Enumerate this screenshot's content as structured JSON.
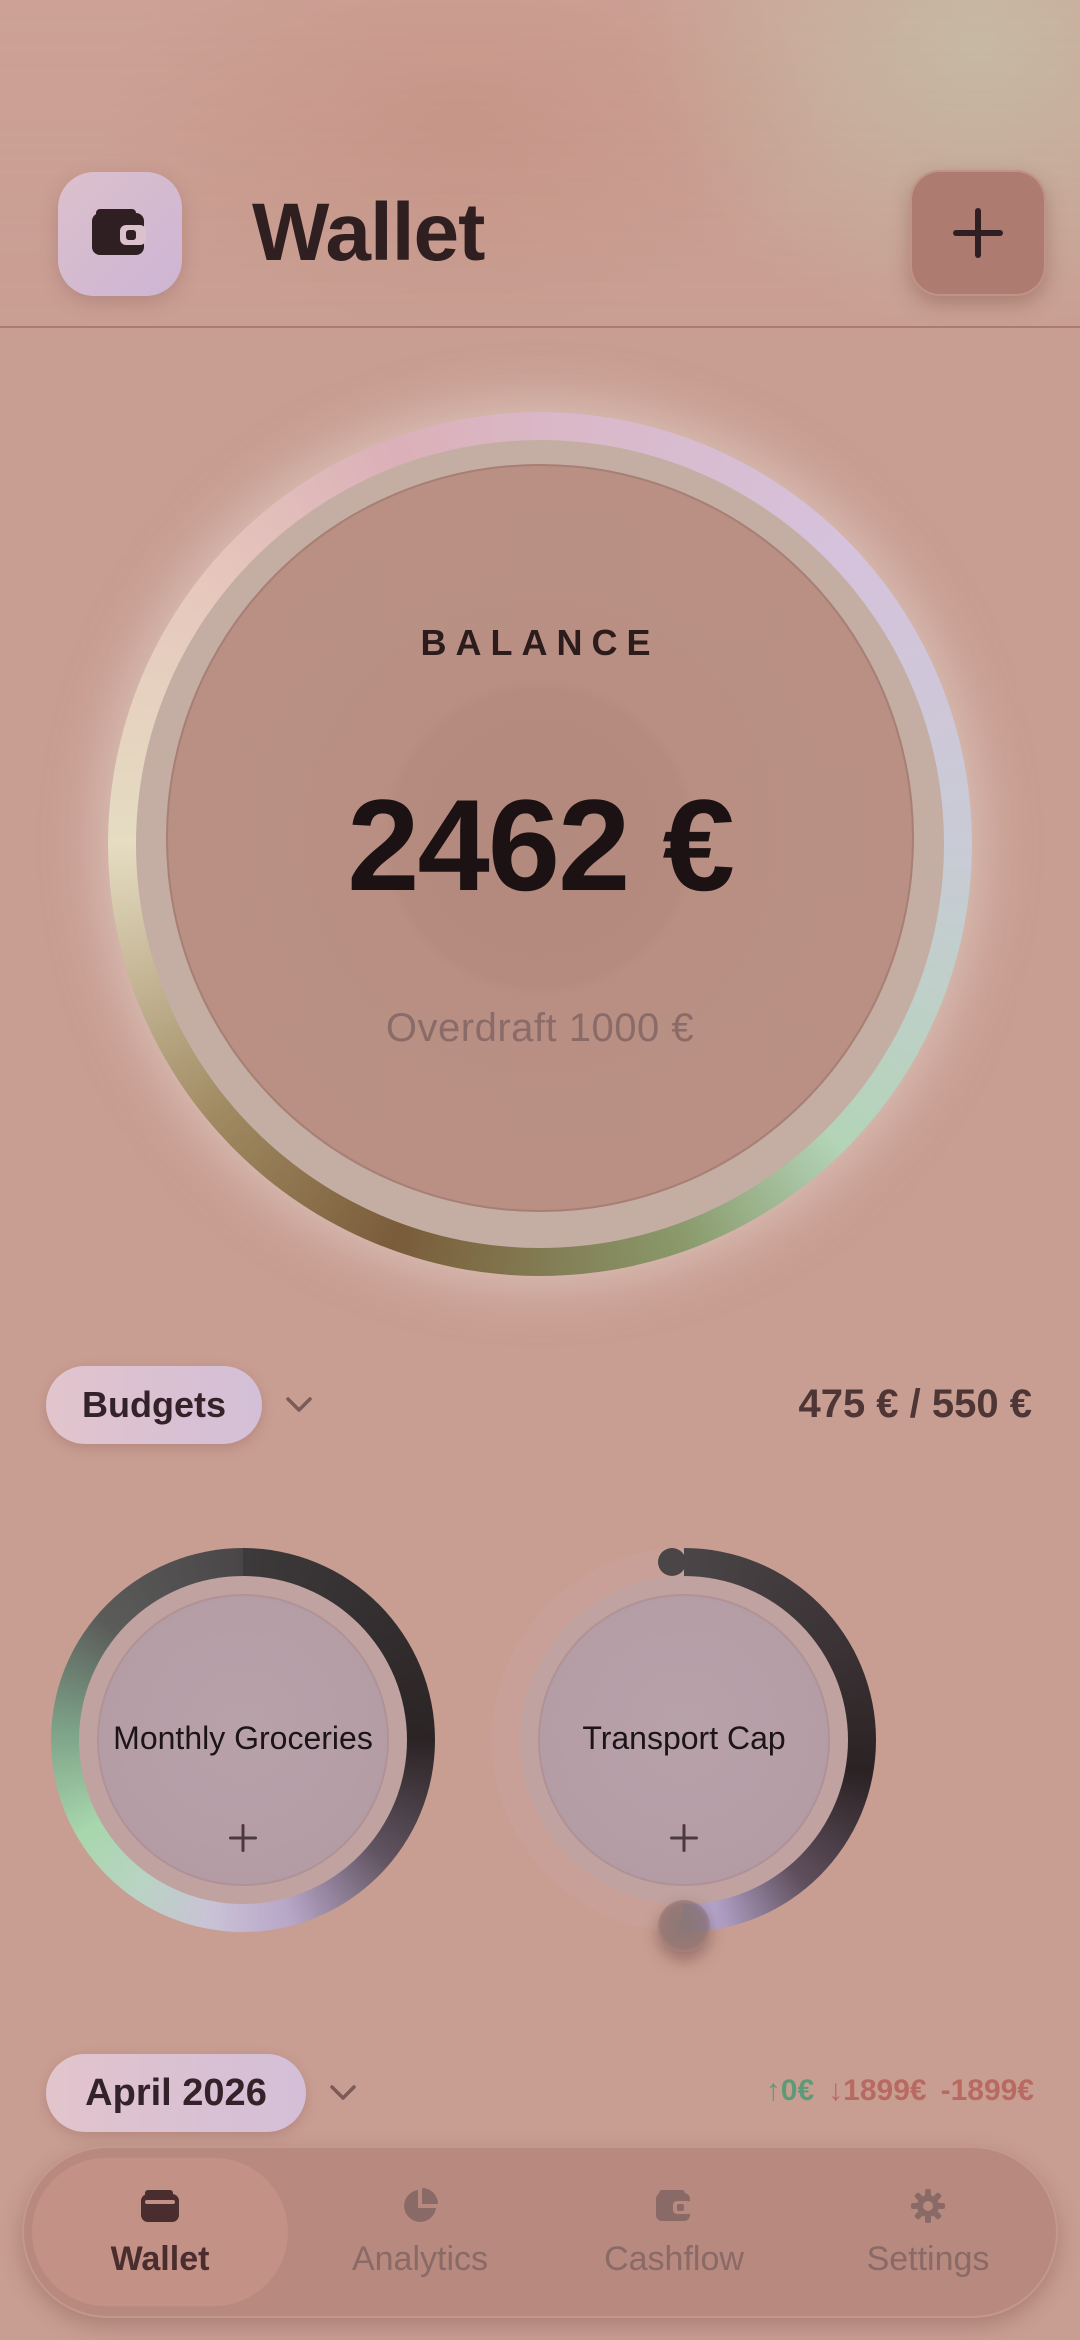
{
  "header": {
    "title": "Wallet",
    "app_icon": "wallet-icon",
    "add_icon": "plus-icon"
  },
  "balance": {
    "label": "BALANCE",
    "amount": "2462 €",
    "overdraft": "Overdraft 1000 €"
  },
  "budgets": {
    "label": "Budgets",
    "total": "475 € / 550 €",
    "items": [
      {
        "name": "Monthly Groceries"
      },
      {
        "name": "Transport Cap"
      }
    ]
  },
  "month": {
    "label": "April 2026",
    "income": "↑0€",
    "expenses": "↓1899€",
    "net": "-1899€"
  },
  "nav": {
    "items": [
      {
        "label": "Wallet",
        "icon": "wallet-icon",
        "active": true
      },
      {
        "label": "Analytics",
        "icon": "pie-chart-icon",
        "active": false
      },
      {
        "label": "Cashflow",
        "icon": "wallet-icon",
        "active": false
      },
      {
        "label": "Settings",
        "icon": "gear-icon",
        "active": false
      }
    ]
  },
  "colors": {
    "background": "#c99e92",
    "income": "#5f9a78",
    "expense": "#b86a62"
  }
}
